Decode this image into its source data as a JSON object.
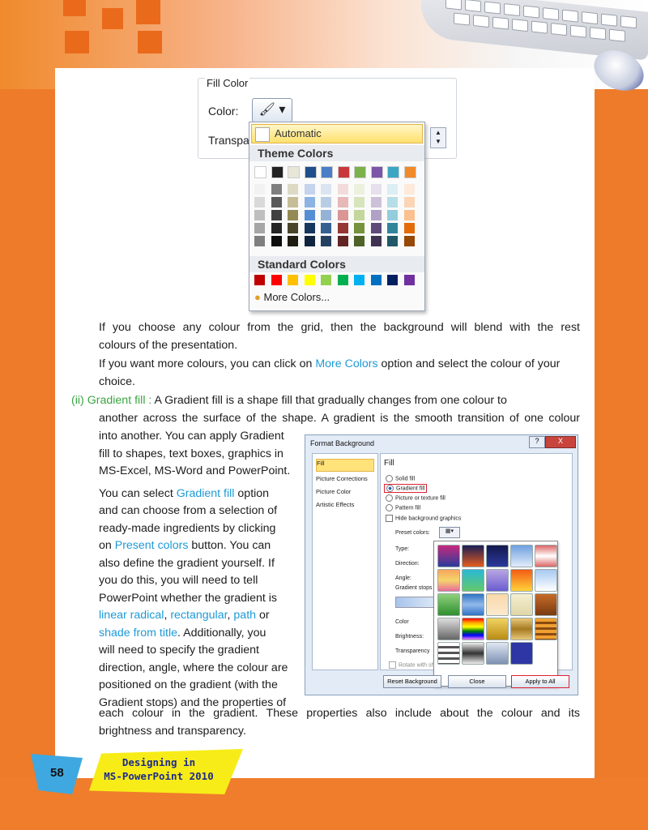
{
  "fill_color": {
    "title": "Fill Color",
    "color_label": "Color:",
    "transparency_label": "Transpa",
    "automatic": "Automatic",
    "theme_colors": "Theme Colors",
    "standard_colors": "Standard Colors",
    "more_colors": "More Colors...",
    "theme_top": [
      "#ffffff",
      "#222222",
      "#e8e6d8",
      "#1f4e8c",
      "#4a7ec7",
      "#c9393b",
      "#7db14a",
      "#7a55a8",
      "#3aa6c4",
      "#f18a2a"
    ],
    "theme_cols": [
      [
        "#f2f2f2",
        "#d9d9d9",
        "#bfbfbf",
        "#a6a6a6",
        "#7f7f7f"
      ],
      [
        "#7f7f7f",
        "#595959",
        "#404040",
        "#262626",
        "#0d0d0d"
      ],
      [
        "#dcd9c4",
        "#c4bd97",
        "#948a54",
        "#4a452a",
        "#1e1c11"
      ],
      [
        "#c5d3ec",
        "#8db3e2",
        "#548dd4",
        "#17365d",
        "#0f243e"
      ],
      [
        "#dbe5f1",
        "#b8cce4",
        "#95b3d7",
        "#366092",
        "#244061"
      ],
      [
        "#f2dcdb",
        "#e6b9b8",
        "#d99694",
        "#953735",
        "#632523"
      ],
      [
        "#ebf1dd",
        "#d7e4bc",
        "#c3d69b",
        "#76923c",
        "#4f6228"
      ],
      [
        "#e5e0ec",
        "#ccc1d9",
        "#b2a1c7",
        "#5f497a",
        "#3f3151"
      ],
      [
        "#dbeef3",
        "#b7dde8",
        "#92cddc",
        "#31859b",
        "#205867"
      ],
      [
        "#fdeada",
        "#fbd5b5",
        "#fac08f",
        "#e36c09",
        "#974806"
      ]
    ],
    "standard": [
      "#c00000",
      "#ff0000",
      "#ffc000",
      "#ffff00",
      "#92d050",
      "#00b050",
      "#00b0f0",
      "#0070c0",
      "#002060",
      "#7030a0"
    ]
  },
  "paragraphs": {
    "p1_line1": "If you choose any colour from the grid, then the background will blend with the rest",
    "p1_line2": "colours of the presentation.",
    "p2_pre": "If you want more colours, you can click on ",
    "p2_link": "More Colors",
    "p2_post": " option and select the colour of your",
    "p2_line2": "choice.",
    "gf_num": "(ii)",
    "gf_head": "Gradient fill :",
    "gf_line1": " A Gradient fill is a shape fill that gradually changes from one colour to",
    "gf_line2": "another across the surface of the shape. A gradient is the smooth transition of one colour",
    "l1": "into another. You can apply Gradient",
    "l2": "fill to shapes, text boxes, graphics in",
    "l3": "MS-Excel, MS-Word and PowerPoint.",
    "l4_pre": "You can select ",
    "l4_link": "Gradient fill",
    "l4_post": " option",
    "l5": "and can choose from a selection of",
    "l6": "ready-made ingredients by clicking",
    "l7_pre": "on ",
    "l7_link": "Present colors",
    "l7_post": " button. You can",
    "l8": "also define the gradient yourself. If",
    "l9": "you do this, you will need to tell",
    "l10": "PowerPoint whether the gradient is",
    "l11_a": "linear radical",
    "l11_b": "rectangular",
    "l11_c": "path",
    "l11_or": " or",
    "l12_link": "shade from title",
    "l12_post": ". Additionally, you",
    "l13": "will need to specify the gradient",
    "l14": "direction, angle, where the colour are",
    "l15": "positioned on the gradient (with the",
    "l16": "Gradient stops) and the properties of",
    "last1": "each colour in the gradient. These properties also include about the colour and its",
    "last2": "brightness and transparency."
  },
  "dialog": {
    "title": "Format Background",
    "help": "?",
    "close": "X",
    "nav": [
      "Fill",
      "Picture Corrections",
      "Picture Color",
      "Artistic Effects"
    ],
    "fill_heading": "Fill",
    "options": [
      "Solid fill",
      "Gradient fill",
      "Picture or texture fill",
      "Pattern fill"
    ],
    "hide_bg": "Hide background graphics",
    "preset_label": "Preset colors:",
    "type_label": "Type:",
    "direction_label": "Direction:",
    "angle_label": "Angle:",
    "stops_label": "Gradient stops",
    "color_label": "Color",
    "brightness_label": "Brightness:",
    "transparency_label": "Transparency",
    "rotate_label": "Rotate with shape",
    "buttons": [
      "Reset Background",
      "Close",
      "Apply to All"
    ]
  },
  "footer": {
    "page_number": "58",
    "line1": "Designing in",
    "line2": "MS-PowerPoint 2010"
  }
}
